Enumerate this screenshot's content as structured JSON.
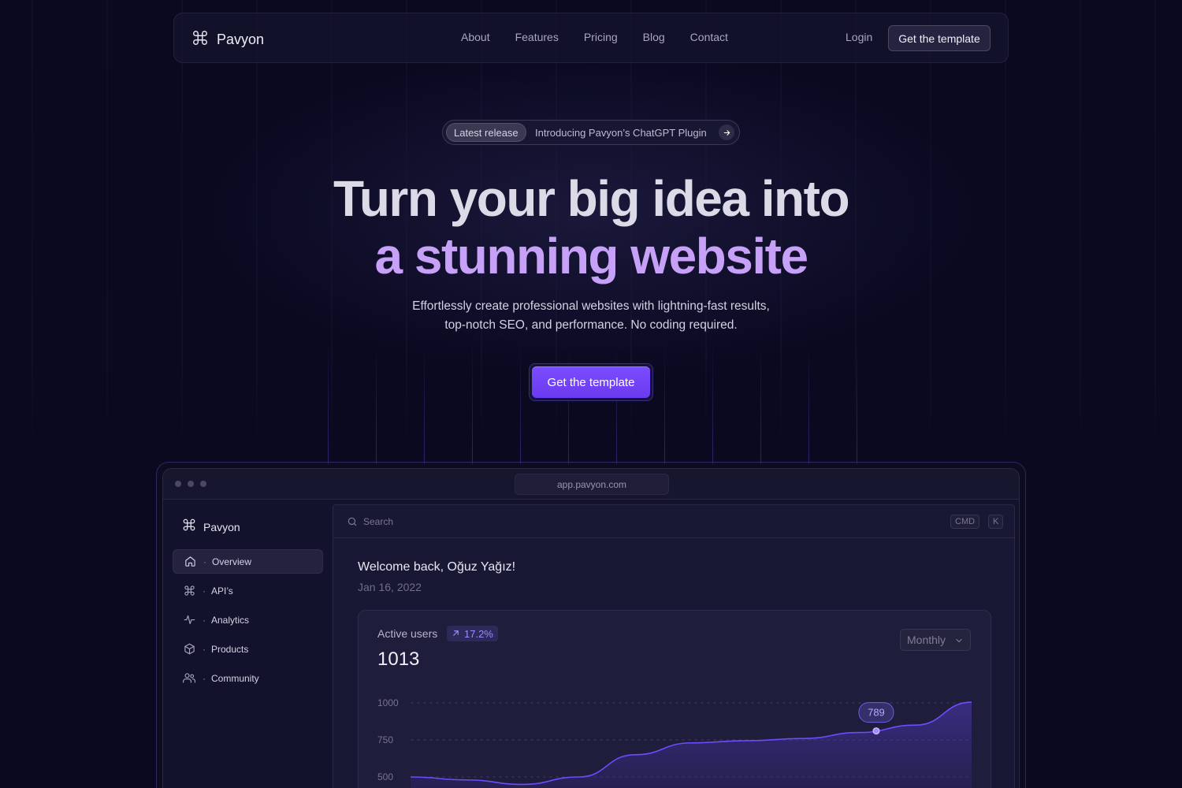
{
  "brand": {
    "name": "Pavyon"
  },
  "nav": {
    "links": [
      "About",
      "Features",
      "Pricing",
      "Blog",
      "Contact"
    ],
    "login": "Login",
    "cta": "Get the template"
  },
  "release": {
    "tag": "Latest release",
    "text": "Introducing Pavyon’s ChatGPT Plugin"
  },
  "hero": {
    "line1": "Turn your big idea into",
    "line2": "a stunning website",
    "subtitle_line1": "Effortlessly create professional websites with lightning-fast results,",
    "subtitle_line2": "top-notch SEO, and performance. No coding required.",
    "cta": "Get the template"
  },
  "app": {
    "url": "app.pavyon.com",
    "sidebar": {
      "brand": "Pavyon",
      "items": [
        {
          "label": "Overview",
          "icon": "home-icon",
          "active": true
        },
        {
          "label": "API’s",
          "icon": "logo-icon",
          "active": false
        },
        {
          "label": "Analytics",
          "icon": "activity-icon",
          "active": false
        },
        {
          "label": "Products",
          "icon": "box-icon",
          "active": false
        },
        {
          "label": "Community",
          "icon": "users-icon",
          "active": false
        }
      ]
    },
    "search": {
      "placeholder": "Search",
      "kbd1": "CMD",
      "kbd2": "K"
    },
    "welcome": "Welcome back, Oğuz Yağız!",
    "date": "Jan 16, 2022",
    "card": {
      "title": "Active users",
      "trend": "17.2%",
      "value": "1013",
      "period": "Monthly"
    }
  },
  "colors": {
    "background": "#0a0920",
    "accent": "#7c4dff",
    "headline_highlight": "#c7a1f8",
    "chart_line": "#6d4bff"
  },
  "chart_data": {
    "type": "area",
    "yticks": [
      1000,
      750,
      500
    ],
    "y_tick_labels": [
      "1000",
      "750",
      "500"
    ],
    "ylim": [
      400,
      1050
    ],
    "x": [
      0,
      0.1,
      0.2,
      0.3,
      0.4,
      0.5,
      0.6,
      0.7,
      0.8,
      0.9,
      1.0
    ],
    "values": [
      500,
      480,
      450,
      500,
      650,
      730,
      745,
      760,
      800,
      850,
      1005
    ],
    "highlight": {
      "x": 0.83,
      "value": 789,
      "label": "789"
    },
    "grid": true
  }
}
